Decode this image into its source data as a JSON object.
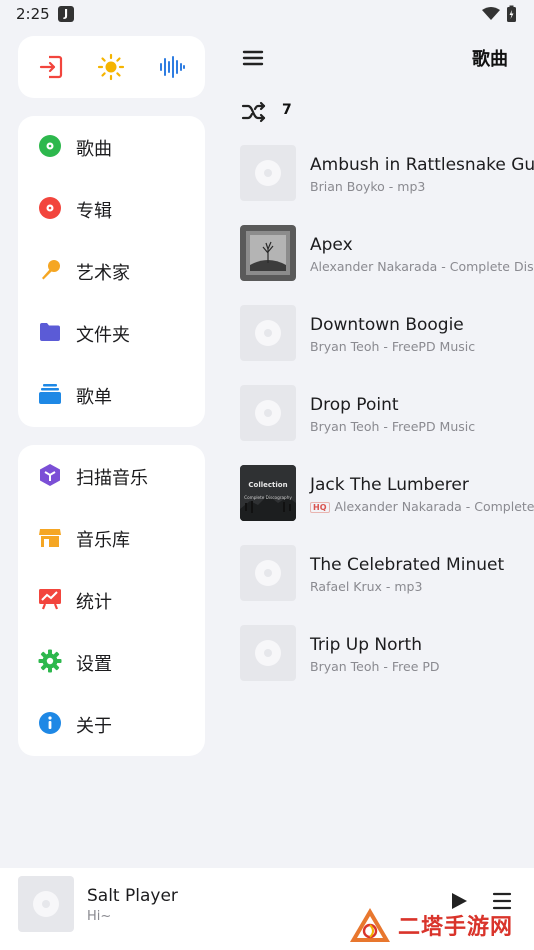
{
  "status_bar": {
    "time": "2:25",
    "app_icon_letter": "J"
  },
  "quick_actions": [
    {
      "icon": "exit-icon",
      "color": "#f2453d"
    },
    {
      "icon": "sun-icon",
      "color": "#f5b400"
    },
    {
      "icon": "equalizer-icon",
      "color": "#2f7de1"
    }
  ],
  "nav_library": [
    {
      "label": "歌曲",
      "icon": "song-disc-icon",
      "color": "#2db84d"
    },
    {
      "label": "专辑",
      "icon": "album-disc-icon",
      "color": "#f2453d"
    },
    {
      "label": "艺术家",
      "icon": "microphone-icon",
      "color": "#f5a623"
    },
    {
      "label": "文件夹",
      "icon": "folder-icon",
      "color": "#5b5bd6"
    },
    {
      "label": "歌单",
      "icon": "playlist-icon",
      "color": "#1e88e5"
    }
  ],
  "nav_tools": [
    {
      "label": "扫描音乐",
      "icon": "scan-cube-icon",
      "color": "#7b4fd6"
    },
    {
      "label": "音乐库",
      "icon": "store-icon",
      "color": "#f5a623"
    },
    {
      "label": "统计",
      "icon": "stats-icon",
      "color": "#f2453d"
    },
    {
      "label": "设置",
      "icon": "gear-icon",
      "color": "#2db84d"
    },
    {
      "label": "关于",
      "icon": "info-icon",
      "color": "#1e88e5"
    }
  ],
  "header": {
    "title": "歌曲",
    "song_count": "7"
  },
  "songs": [
    {
      "title": "Ambush in Rattlesnake Gulch",
      "subtitle": "Brian Boyko - mp3",
      "hq": "",
      "cover": "placeholder"
    },
    {
      "title": "Apex",
      "subtitle": "Alexander Nakarada - Complete Discography",
      "hq": "",
      "cover": "art-apex"
    },
    {
      "title": "Downtown Boogie",
      "subtitle": "Bryan Teoh - FreePD Music",
      "hq": "",
      "cover": "placeholder"
    },
    {
      "title": "Drop Point",
      "subtitle": "Bryan Teoh - FreePD Music",
      "hq": "",
      "cover": "placeholder"
    },
    {
      "title": "Jack The Lumberer",
      "subtitle": "Alexander Nakarada - Complete Discography",
      "hq": "HQ",
      "cover": "art-collection",
      "cover_text_1": "Collection",
      "cover_text_2": "Complete Discography"
    },
    {
      "title": "The Celebrated Minuet",
      "subtitle": "Rafael Krux - mp3",
      "hq": "",
      "cover": "placeholder"
    },
    {
      "title": "Trip Up North",
      "subtitle": "Bryan Teoh - Free PD",
      "hq": "",
      "cover": "placeholder"
    }
  ],
  "mini_player": {
    "title": "Salt Player",
    "subtitle": "Hi~"
  },
  "watermark": {
    "text": "二塔手游网"
  }
}
